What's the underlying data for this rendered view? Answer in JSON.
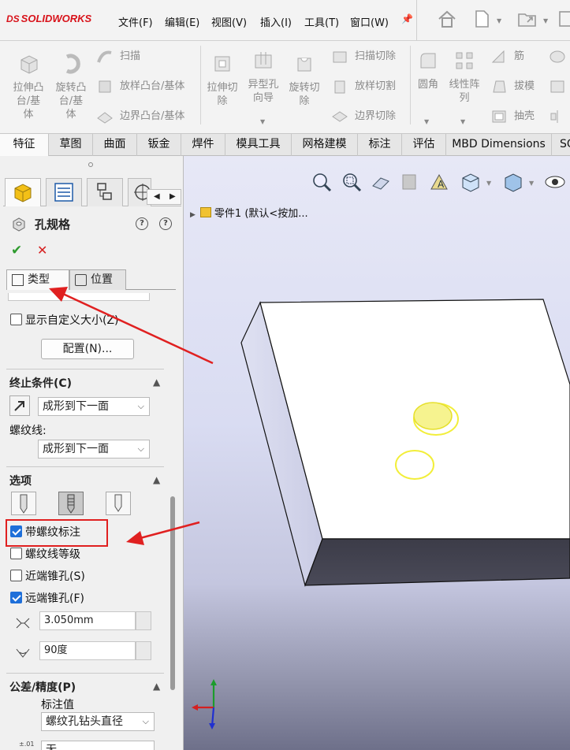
{
  "app": {
    "brand": "SOLIDWORKS",
    "brand_prefix": "DS"
  },
  "menu": [
    "文件(F)",
    "编辑(E)",
    "视图(V)",
    "插入(I)",
    "工具(T)",
    "窗口(W)"
  ],
  "ribbon": {
    "extrude_boss": "拉伸凸\n台/基\n体",
    "revolve_boss": "旋转凸\n台/基\n体",
    "sweep": "扫描",
    "loft_boss": "放样凸台/基体",
    "boundary_boss": "边界凸台/基体",
    "extrude_cut": "拉伸切\n除",
    "hole_wizard": "异型孔\n向导",
    "revolve_cut": "旋转切\n除",
    "sweep_cut": "扫描切除",
    "loft_cut": "放样切割",
    "boundary_cut": "边界切除",
    "fillet": "圆角",
    "linear_pattern": "线性阵\n列",
    "rib": "筋",
    "draft": "拔模",
    "shell": "抽壳"
  },
  "tabs": [
    "特征",
    "草图",
    "曲面",
    "钣金",
    "焊件",
    "模具工具",
    "网格建模",
    "标注",
    "评估",
    "MBD Dimensions",
    "SO"
  ],
  "active_tab": 0,
  "pm": {
    "title": "孔规格",
    "subtab_type": "类型",
    "subtab_position": "位置",
    "show_custom_size": "显示自定义大小(Z)",
    "config_button": "配置(N)...",
    "end_condition_header": "终止条件(C)",
    "end_condition_value": "成形到下一面",
    "thread_label": "螺纹线:",
    "thread_value": "成形到下一面",
    "options_header": "选项",
    "with_thread_callout": "带螺纹标注",
    "with_thread_callout_checked": true,
    "thread_class": "螺纹线等级",
    "thread_class_checked": false,
    "near_countersink": "近端锥孔(S)",
    "near_countersink_checked": false,
    "far_countersink": "远端锥孔(F)",
    "far_countersink_checked": true,
    "far_cs_diameter": "3.050mm",
    "far_cs_angle": "90度",
    "tolerance_header": "公差/精度(P)",
    "callout_value_label": "标注值",
    "callout_value": "螺纹孔钻头直径",
    "tolerance_type": "无"
  },
  "viewport": {
    "tree_item": "零件1  (默认<按加..."
  },
  "colors": {
    "accent_red": "#e02020",
    "checkbox_blue": "#1e6fd9",
    "hole_yellow": "#f2ee3a"
  }
}
